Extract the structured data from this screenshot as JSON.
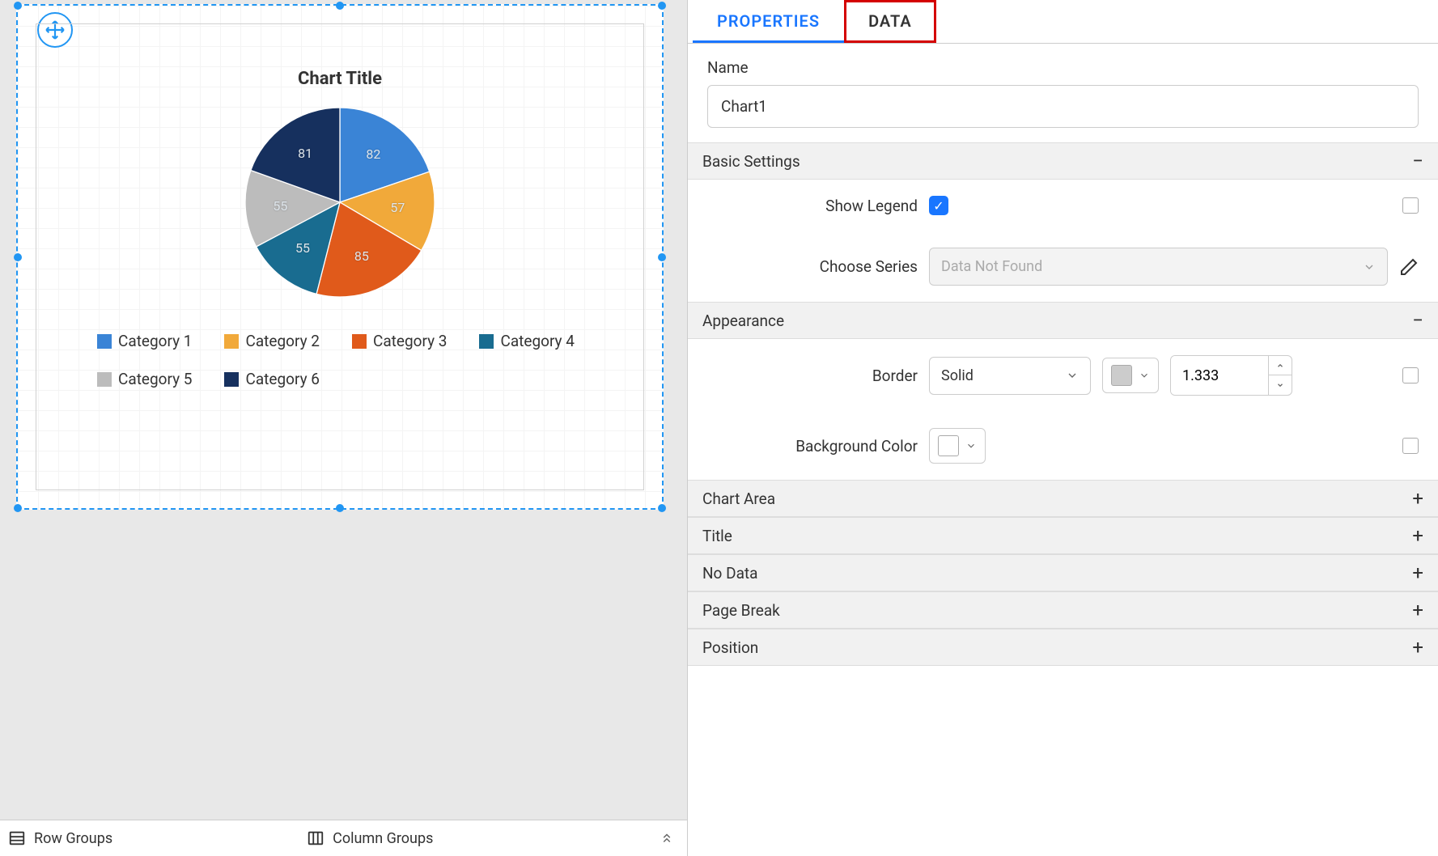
{
  "tabs": {
    "properties": "PROPERTIES",
    "data": "DATA"
  },
  "name_section": {
    "label": "Name",
    "value": "Chart1"
  },
  "sections": {
    "basic": {
      "title": "Basic Settings",
      "show_legend_label": "Show Legend",
      "show_legend": true,
      "choose_series_label": "Choose Series",
      "choose_series_placeholder": "Data Not Found"
    },
    "appearance": {
      "title": "Appearance",
      "border_label": "Border",
      "border_style": "Solid",
      "border_width": "1.333",
      "bg_label": "Background Color"
    },
    "chart_area": "Chart Area",
    "title": "Title",
    "no_data": "No Data",
    "page_break": "Page Break",
    "position": "Position"
  },
  "footer": {
    "row_groups": "Row Groups",
    "column_groups": "Column Groups"
  },
  "chart_data": {
    "type": "pie",
    "title": "Chart Title",
    "series": [
      {
        "name": "Category 1",
        "value": 82,
        "color": "#3a84d6"
      },
      {
        "name": "Category 2",
        "value": 57,
        "color": "#f1a93a"
      },
      {
        "name": "Category 3",
        "value": 85,
        "color": "#e05a1b"
      },
      {
        "name": "Category 4",
        "value": 55,
        "color": "#196c90"
      },
      {
        "name": "Category 5",
        "value": 55,
        "color": "#bcbcbc"
      },
      {
        "name": "Category 6",
        "value": 81,
        "color": "#16305e"
      }
    ]
  }
}
